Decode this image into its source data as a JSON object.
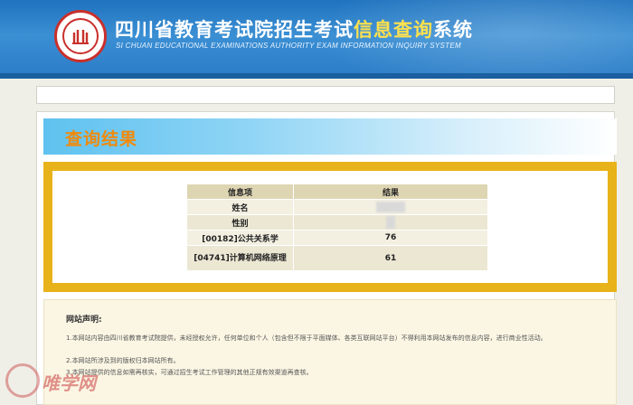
{
  "header": {
    "title_cn_prefix": "四川省教育考试院招生考试",
    "title_cn_highlight": "信息查询",
    "title_cn_suffix": "系统",
    "title_en": "SI CHUAN EDUCATIONAL EXAMINATIONS AUTHORITY EXAM INFORMATION INQUIRY SYSTEM",
    "logo_icon": "seal-emblem-icon"
  },
  "colors": {
    "header_blue": "#2a7cc7",
    "title_highlight": "#ffe14d",
    "result_title": "#f08a0c",
    "frame_yellow": "#e8b21a"
  },
  "result": {
    "title": "查询结果",
    "headers": [
      "信息项",
      "结果"
    ],
    "rows": [
      {
        "item": "姓名",
        "value": ""
      },
      {
        "item": "性别",
        "value": ""
      },
      {
        "item": "[00182]公共关系学",
        "value": "76"
      },
      {
        "item": "[04741]计算机网络原理",
        "value": "61"
      }
    ]
  },
  "notice": {
    "title": "网站声明:",
    "line1": "1.本网站内容由四川省教育考试院提供，未经授权允许，任何单位和个人（包含但不限于平面媒体、各类互联网站平台）不得利用本网站发布的信息内容，进行商业性活动。",
    "line2": "2.本网站所涉及到的版权归本网站所有。",
    "line3": "3.本网站提供的信息如需再核实，可通过招生考试工作管理的其他正规有效渠道再查核。"
  },
  "watermark": {
    "text": "唯学网"
  }
}
